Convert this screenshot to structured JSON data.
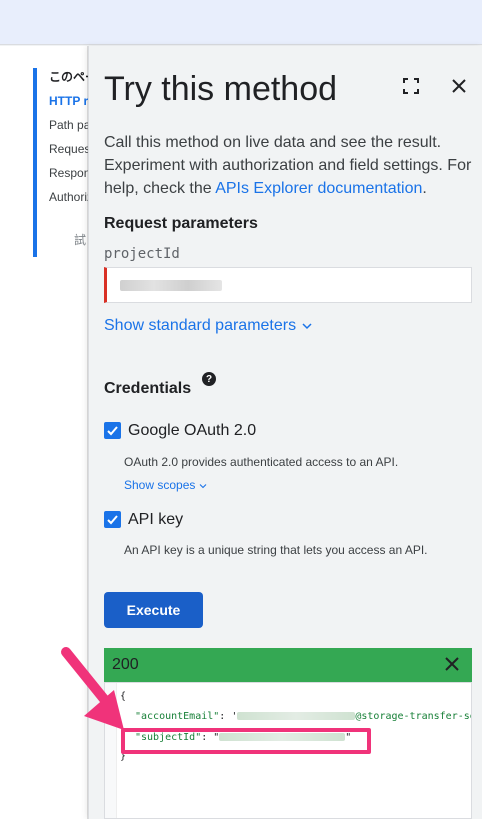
{
  "left_nav": {
    "title": "このページ",
    "items": [
      {
        "label": "HTTP request",
        "active": true
      },
      {
        "label": "Path parameters",
        "active": false
      },
      {
        "label": "Request body",
        "active": false
      },
      {
        "label": "Response body",
        "active": false
      },
      {
        "label": "Authorization scopes",
        "active": false
      }
    ],
    "try_label": "試してみる"
  },
  "panel": {
    "title": "Try this method",
    "fullscreen_icon": "fullscreen-icon",
    "close_icon": "close-icon",
    "description": "Call this method on live data and see the result. Experiment with authorization and field settings. For help, check the ",
    "description_link": "APIs Explorer documentation",
    "description_end": "."
  },
  "request": {
    "heading": "Request parameters",
    "param_name": "projectId",
    "show_standard": "Show standard parameters"
  },
  "credentials": {
    "heading": "Credentials",
    "help_icon": "help-icon",
    "oauth": {
      "label": "Google OAuth 2.0",
      "checked": true,
      "description": "OAuth 2.0 provides authenticated access to an API.",
      "show_scopes": "Show scopes"
    },
    "apikey": {
      "label": "API key",
      "checked": true,
      "description": "An API key is a unique string that lets you access an API."
    }
  },
  "execute_label": "Execute",
  "response": {
    "status": "200",
    "open_brace": "{",
    "close_brace": "}",
    "key1": "\"accountEmail\"",
    "sep1": ": '",
    "val1_suffix": "@storage-transfer-se",
    "key2": "\"subjectId\"",
    "sep2": ": \"",
    "val2_end": "\""
  },
  "colors": {
    "accent": "#1a73e8",
    "success": "#34a853",
    "highlight": "#f0337a",
    "error_marker": "#d93025"
  }
}
